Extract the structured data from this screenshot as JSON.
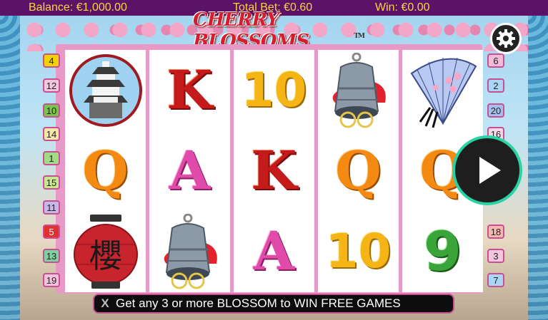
{
  "topbar": {
    "balance": "Balance: €1,000.00",
    "total_bet": "Total Bet: €0.60",
    "win": "Win: €0.00"
  },
  "logo": {
    "text": "Cherry Blossoms",
    "tm": "TM"
  },
  "paylines": {
    "left": [
      "4",
      "12",
      "10",
      "14",
      "1",
      "15",
      "11",
      "5",
      "13",
      "19"
    ],
    "right": [
      "6",
      "2",
      "20",
      "16",
      "",
      "",
      "",
      "18",
      "3",
      "7"
    ],
    "left_colors": [
      "#f2d300",
      "#c94f93",
      "#2f9a2f",
      "#e2a7d0",
      "#6bc04a",
      "#b5d77a",
      "#7b4aa0",
      "#d62828",
      "#2e9e56",
      "#c94f93"
    ],
    "right_colors": [
      "#c94f93",
      "#3b9ae0",
      "#2a5fb0",
      "#e2a7d0",
      "",
      "",
      "",
      "#f08a8a",
      "#c94f93",
      "#3b9ae0"
    ]
  },
  "reels": [
    [
      "castle-icon",
      "Q",
      "lantern-icon"
    ],
    [
      "K",
      "A",
      "bell-icon"
    ],
    [
      "10",
      "K",
      "A"
    ],
    [
      "bell-icon",
      "Q",
      "10"
    ],
    [
      "fan-icon",
      "Q",
      "9"
    ]
  ],
  "message": {
    "x_label": "X",
    "text": "Get any 3 or more BLOSSOM to WIN FREE GAMES"
  },
  "lantern_char": "櫻"
}
